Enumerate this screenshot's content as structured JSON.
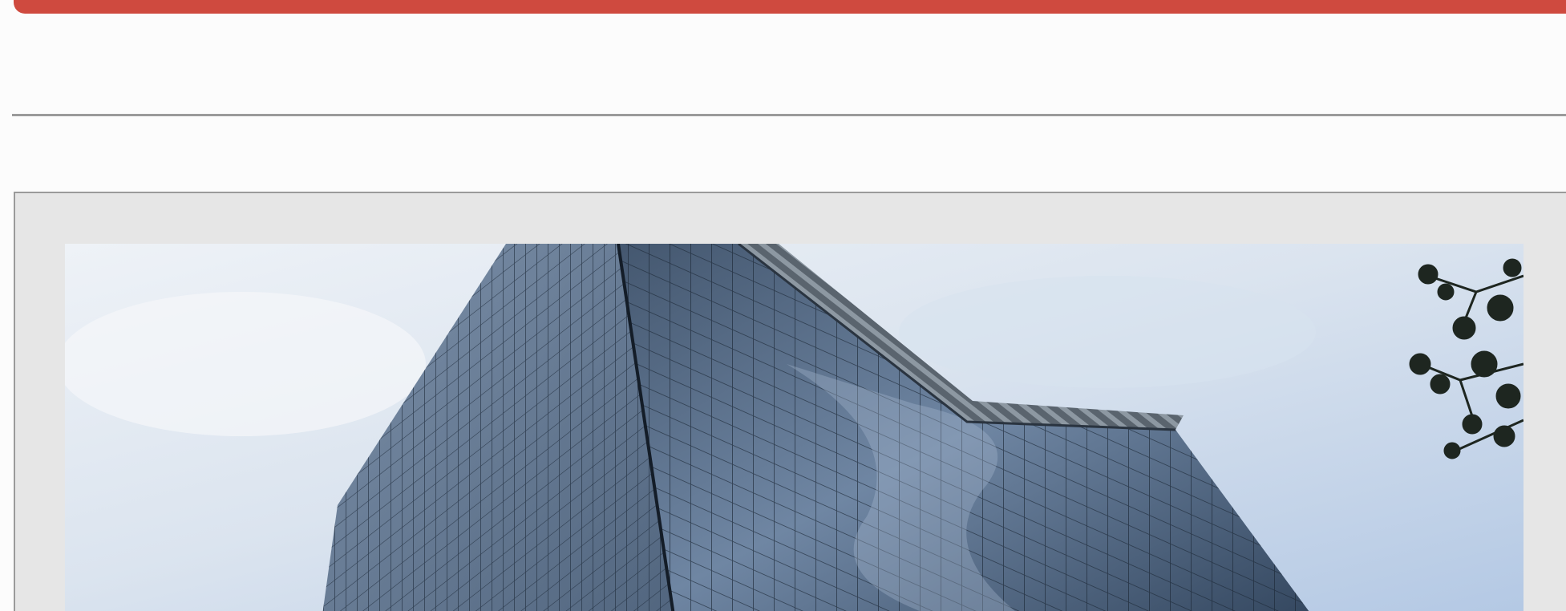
{
  "colors": {
    "accent": "#cf4a3f",
    "divider": "#9b9b9b",
    "frame_background": "#e6e6e6",
    "page_background": "#fcfcfc",
    "sky_light": "#eef2f7",
    "sky_blue": "#b3c8e4",
    "glass_dark": "#33465e",
    "glass_mid": "#6f86a3"
  },
  "image": {
    "subject": "glass-skyscraper-photo",
    "icon": "image-icon"
  }
}
